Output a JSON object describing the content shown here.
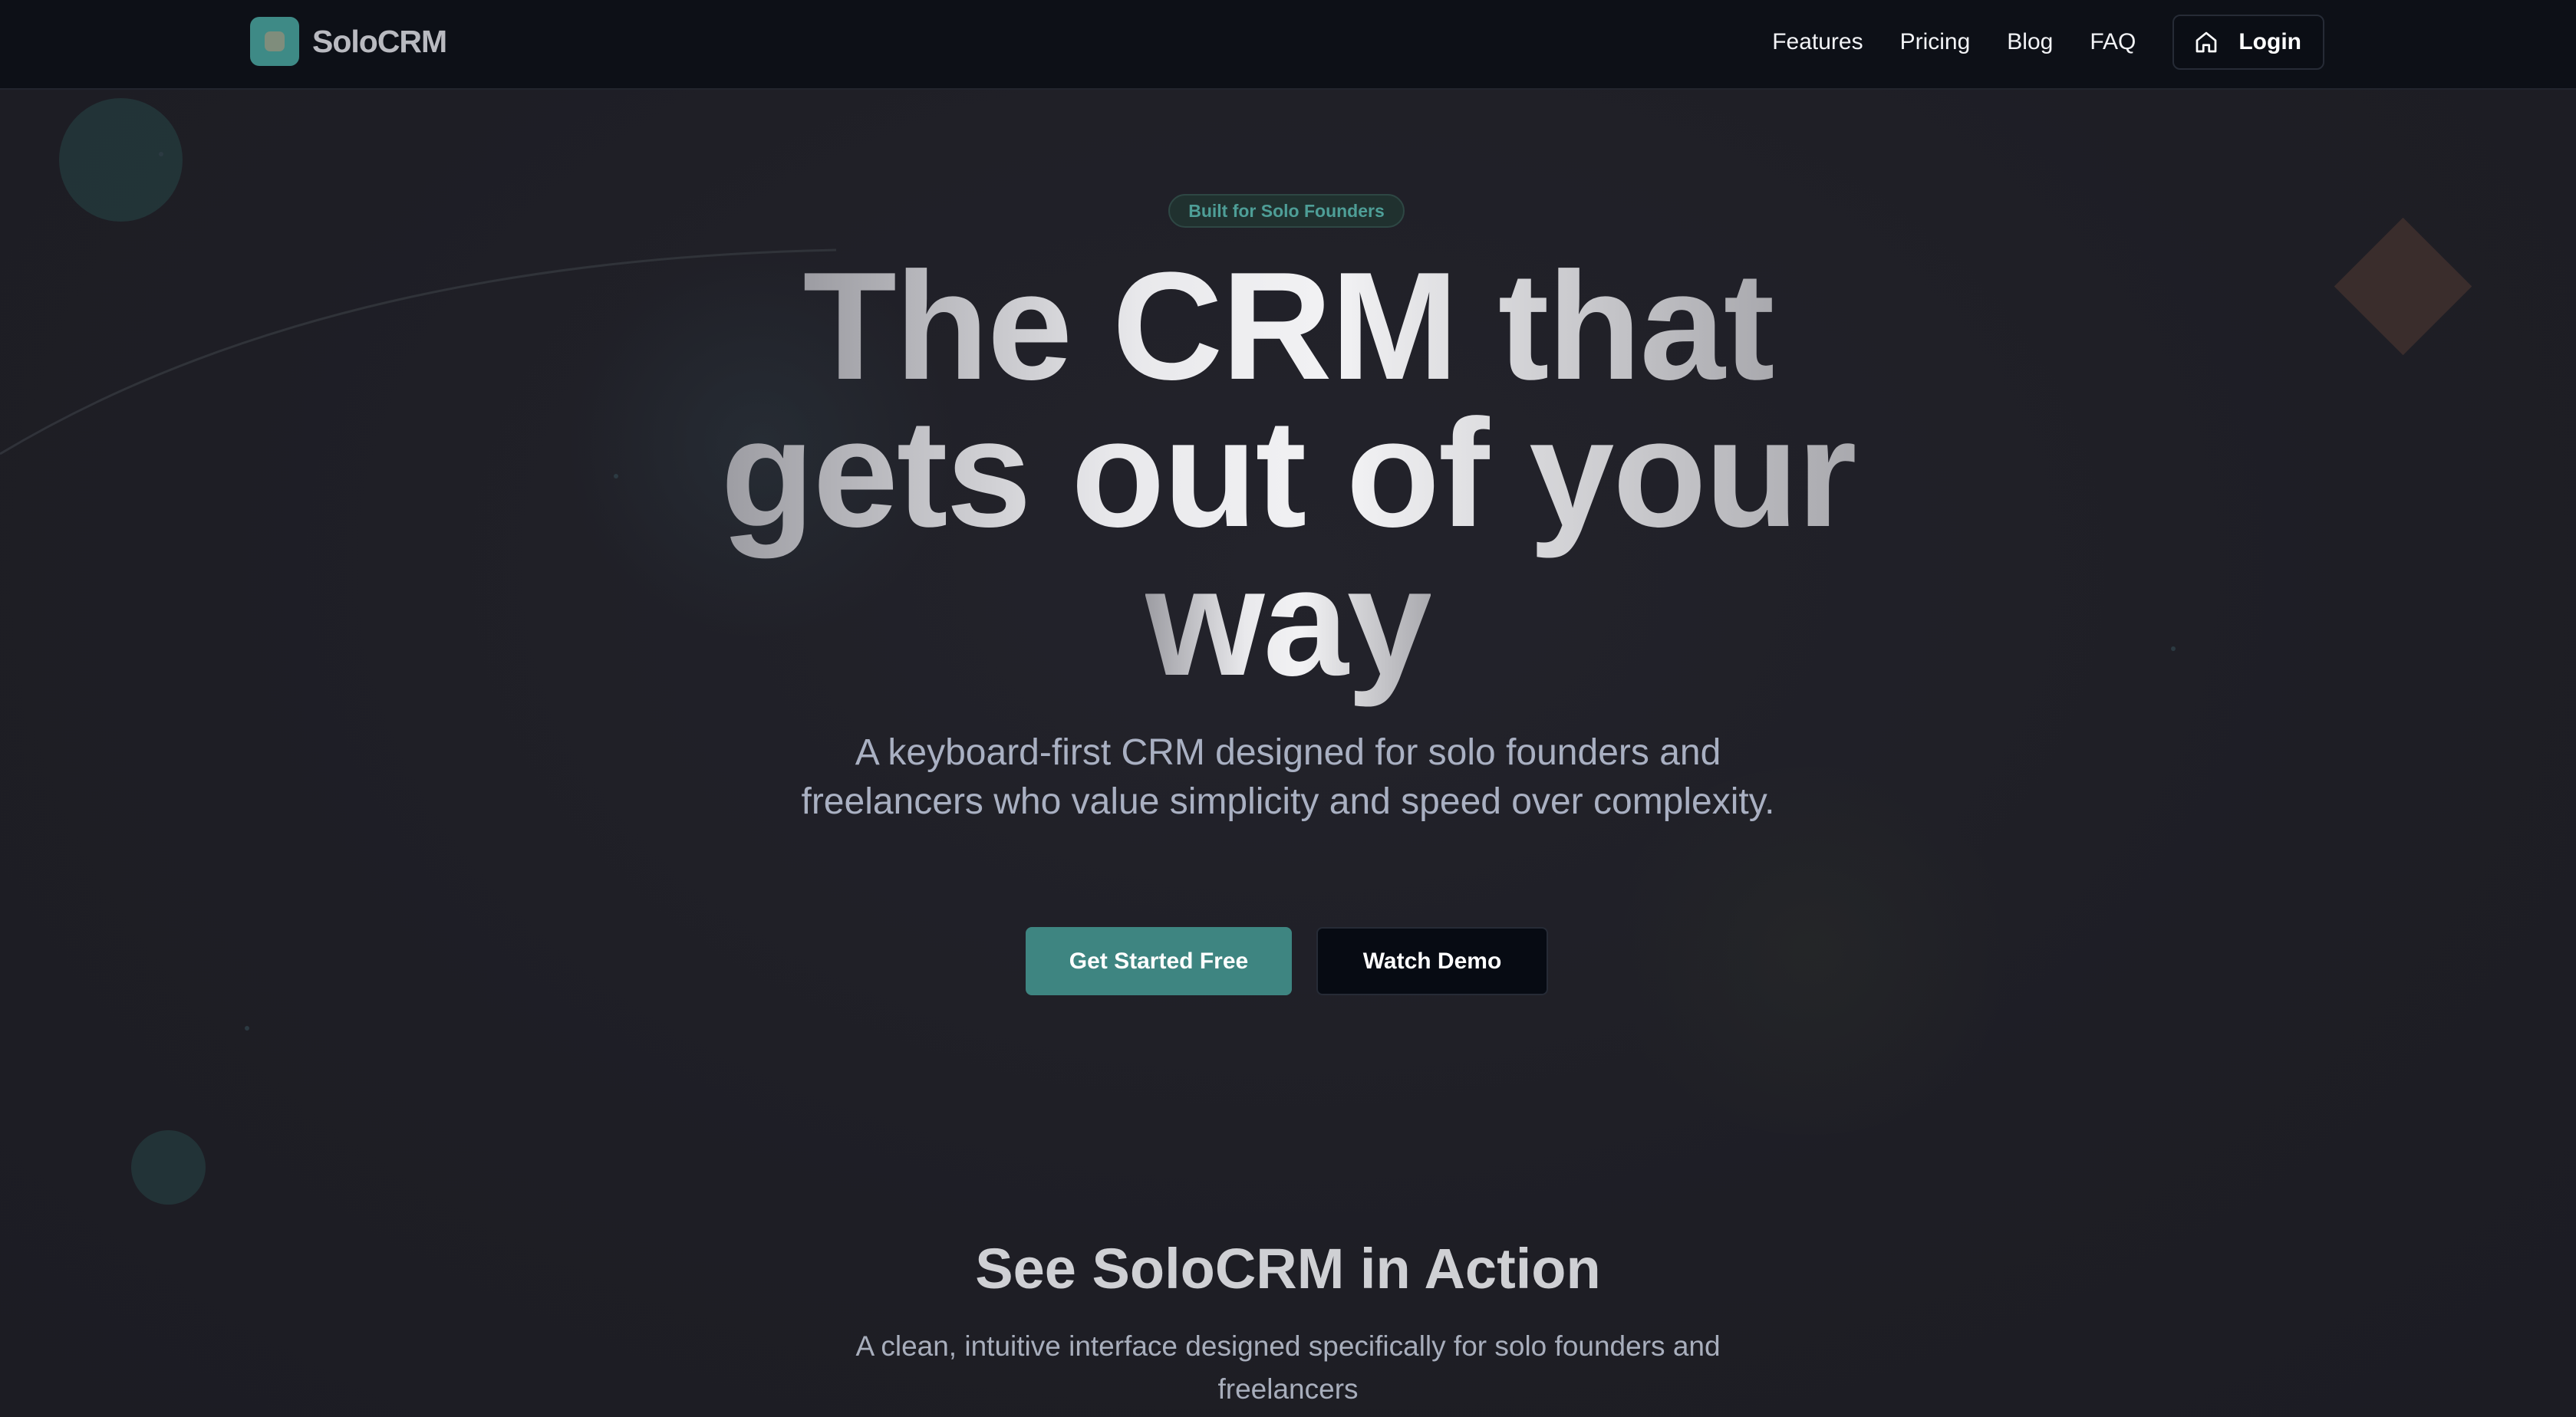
{
  "header": {
    "brand": "SoloCRM",
    "nav": [
      "Features",
      "Pricing",
      "Blog",
      "FAQ"
    ],
    "login_label": "Login"
  },
  "hero": {
    "badge": "Built for Solo Founders",
    "headline_lines": [
      "The CRM that",
      "gets out of your",
      "way"
    ],
    "subtitle": "A keyboard-first CRM designed for solo founders and freelancers who value simplicity and speed over complexity.",
    "primary_cta": "Get Started Free",
    "secondary_cta": "Watch Demo"
  },
  "section": {
    "title": "See SoloCRM in Action",
    "subtitle": "A clean, intuitive interface designed specifically for solo founders and freelancers"
  },
  "colors": {
    "accent": "#3e8581",
    "background": "#1f1f26",
    "header_bg": "#0d1017"
  },
  "icons": {
    "logo": "app-logo-icon",
    "login": "home-icon"
  }
}
